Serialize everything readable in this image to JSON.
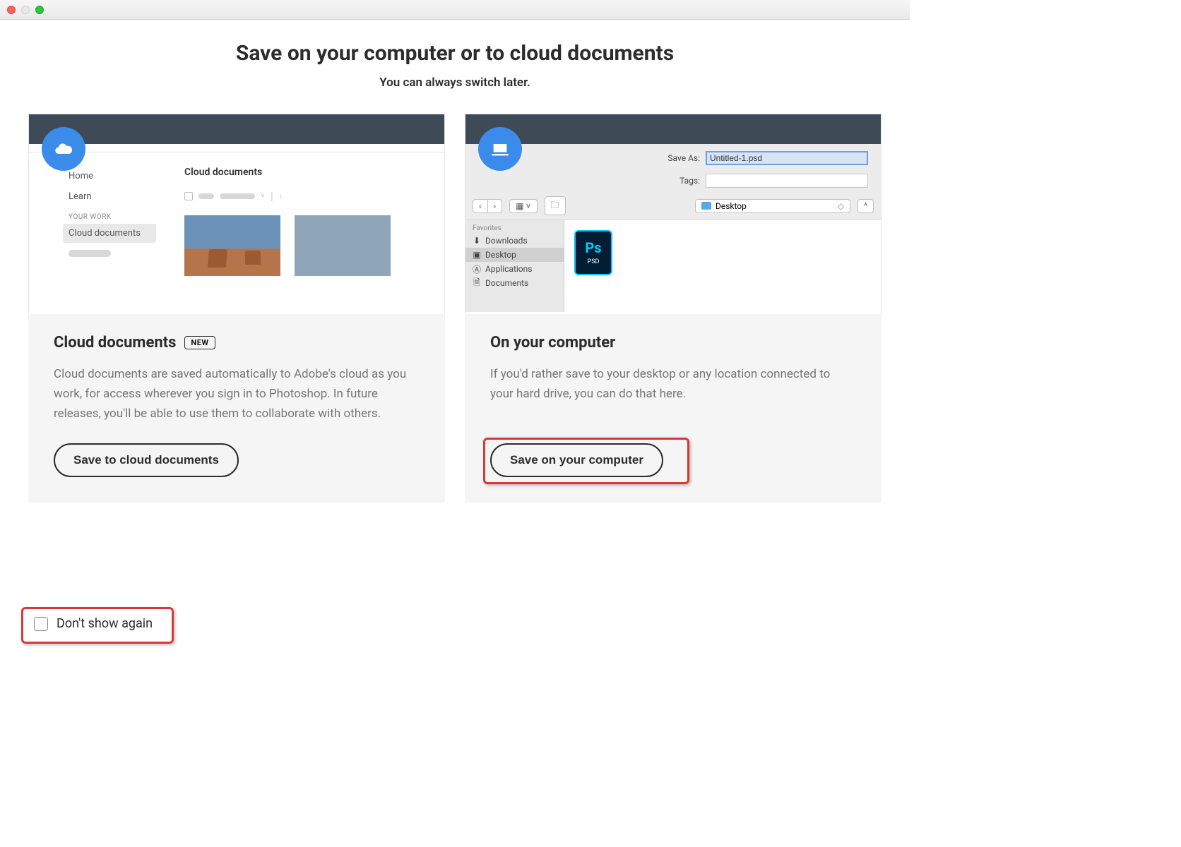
{
  "titlebar": {},
  "heading": {
    "title": "Save on your computer or to cloud documents",
    "subtitle": "You can always switch later."
  },
  "cloud_card": {
    "sidebar": {
      "home": "Home",
      "learn": "Learn",
      "your_work": "YOUR WORK",
      "cloud_docs": "Cloud documents"
    },
    "main_title": "Cloud documents",
    "title": "Cloud documents",
    "badge": "NEW",
    "desc": "Cloud documents are saved automatically to Adobe's cloud as you work, for access wherever you sign in to Photoshop. In future releases, you'll be able to use them to collaborate with others.",
    "button": "Save to cloud documents"
  },
  "computer_card": {
    "save_as_label": "Save As:",
    "save_as_value": "Untitled-1.psd",
    "tags_label": "Tags:",
    "location": "Desktop",
    "favorites_label": "Favorites",
    "favorites": {
      "downloads": "Downloads",
      "desktop": "Desktop",
      "applications": "Applications",
      "documents": "Documents"
    },
    "psd_label_top": "Ps",
    "psd_label_bottom": "PSD",
    "title": "On your computer",
    "desc": "If you'd rather save to your desktop or any location connected to your hard drive, you can do that here.",
    "button": "Save on your computer"
  },
  "footer": {
    "dont_show": "Don't show again"
  }
}
